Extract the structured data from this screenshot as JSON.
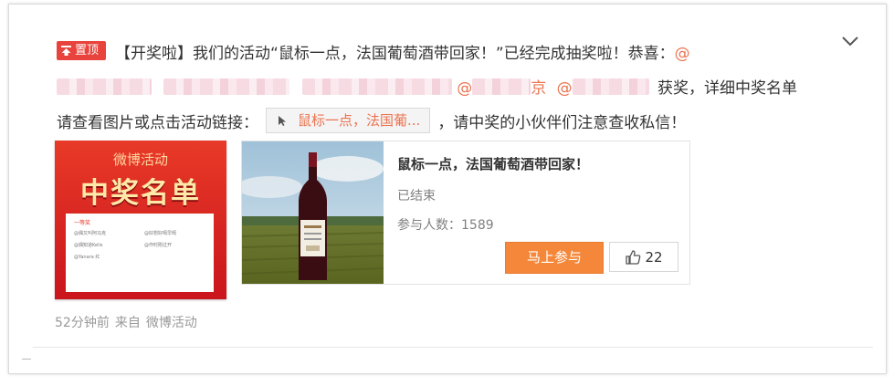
{
  "post": {
    "pin_label": "置顶",
    "prefix": "【开奖啦】我们的活动“鼠标一点，法国葡萄酒带回家！”已经完成抽奖啦！恭喜：",
    "mention_at": "@",
    "line2_mention_start": "@",
    "line2_partial_name": "京",
    "line2_mention_2": "@",
    "line2_suffix": "获奖，详细中奖名单",
    "line3_prefix": "请查看图片或点击活动链接：",
    "link_label": "鼠标一点，法国葡...",
    "line3_suffix": "，请中奖的小伙伴们注意查收私信！"
  },
  "poster": {
    "subtitle": "微博活动",
    "title": "中奖名单",
    "sheet_heading": "一等奖",
    "rows": [
      "@偶又叫阿马克",
      "@好想好嗝早嗝",
      "@偶知道Kelis",
      "@作时刚过开",
      "@Yanara 红"
    ]
  },
  "activity_card": {
    "title": "鼠标一点，法国葡萄酒带回家！",
    "status": "已结束",
    "participants": "参与人数：1589",
    "join_label": "马上参与",
    "like_count": "22"
  },
  "meta": {
    "time": "52分钟前",
    "source_prefix": "来自",
    "source": "微博活动"
  },
  "icons": [
    "chevron-down-icon",
    "pin-icon",
    "link-icon",
    "thumbs-up-icon"
  ],
  "colors": {
    "accent": "#eb7350",
    "pin": "#e8433c",
    "join": "#f5873a"
  }
}
